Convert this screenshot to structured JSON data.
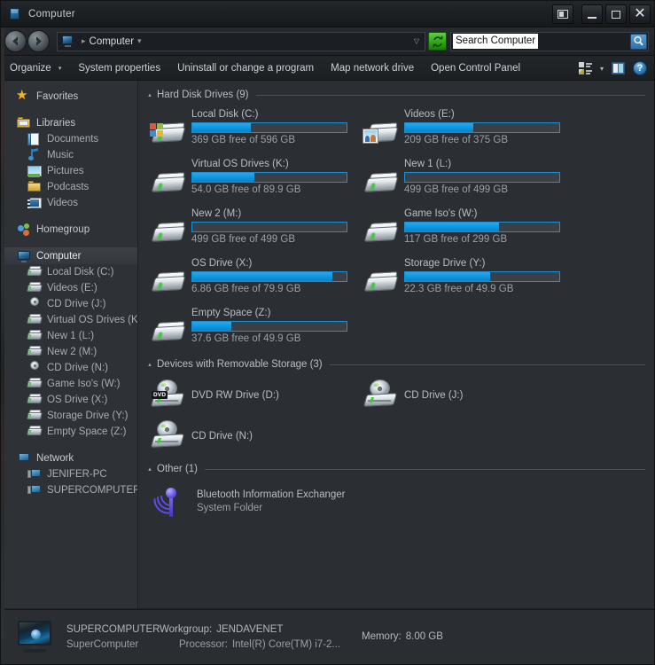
{
  "window": {
    "title": "Computer",
    "title_icon": "computer-icon",
    "controls": {
      "restore_down": "restore-down-icon",
      "minimize": "minimize-icon",
      "maximize": "maximize-icon",
      "close": "close-icon"
    }
  },
  "addressbar": {
    "back": "back-arrow-icon",
    "forward": "forward-arrow-icon",
    "crumb_icon": "computer-icon",
    "crumb": "Computer",
    "sep_left": "▸",
    "sep_right": "▾",
    "history_caret": "▽",
    "refresh": "refresh-icon"
  },
  "search": {
    "value": "Search Computer",
    "placeholder": "Search Computer",
    "icon": "search-icon"
  },
  "toolbar": {
    "items": [
      {
        "label": "Organize",
        "has_caret": true
      },
      {
        "label": "System properties",
        "has_caret": false
      },
      {
        "label": "Uninstall or change a program",
        "has_caret": false
      },
      {
        "label": "Map network drive",
        "has_caret": false
      },
      {
        "label": "Open Control Panel",
        "has_caret": false
      }
    ],
    "caret": "▾",
    "view_icon": "view-options-icon",
    "view_caret": "▾",
    "preview_pane_icon": "preview-pane-icon",
    "help_icon": "help-icon",
    "help_glyph": "?"
  },
  "navpane": {
    "favorites": {
      "label": "Favorites",
      "icon": "star-icon"
    },
    "libraries": {
      "label": "Libraries",
      "icon": "library-icon",
      "items": [
        {
          "label": "Documents",
          "icon": "documents-icon"
        },
        {
          "label": "Music",
          "icon": "music-icon"
        },
        {
          "label": "Pictures",
          "icon": "pictures-icon"
        },
        {
          "label": "Podcasts",
          "icon": "podcasts-icon"
        },
        {
          "label": "Videos",
          "icon": "videos-icon"
        }
      ]
    },
    "homegroup": {
      "label": "Homegroup",
      "icon": "homegroup-icon"
    },
    "computer": {
      "label": "Computer",
      "icon": "computer-icon",
      "selected": true,
      "items": [
        {
          "label": "Local Disk (C:)",
          "icon": "hdd-windows-icon"
        },
        {
          "label": "Videos (E:)",
          "icon": "hdd-pictures-icon"
        },
        {
          "label": "CD Drive (J:)",
          "icon": "cd-drive-icon"
        },
        {
          "label": "Virtual OS Drives (K:",
          "icon": "hdd-icon"
        },
        {
          "label": "New 1 (L:)",
          "icon": "hdd-icon"
        },
        {
          "label": "New 2 (M:)",
          "icon": "hdd-icon"
        },
        {
          "label": "CD Drive (N:)",
          "icon": "cd-drive-icon"
        },
        {
          "label": "Game Iso's (W:)",
          "icon": "hdd-icon"
        },
        {
          "label": "OS Drive (X:)",
          "icon": "hdd-icon"
        },
        {
          "label": "Storage Drive (Y:)",
          "icon": "hdd-icon"
        },
        {
          "label": "Empty Space (Z:)",
          "icon": "hdd-icon"
        }
      ]
    },
    "network": {
      "label": "Network",
      "icon": "network-icon",
      "items": [
        {
          "label": "JENIFER-PC",
          "icon": "network-computer-icon"
        },
        {
          "label": "SUPERCOMPUTER",
          "icon": "network-computer-icon"
        }
      ]
    }
  },
  "content": {
    "sections": [
      {
        "title": "Hard Disk Drives (9)",
        "caret": "▴",
        "kind": "drives",
        "items": [
          {
            "name": "Local Disk (C:)",
            "sub": "369 GB free of 596 GB",
            "used_pct": 38,
            "icon": "hdd-windows-icon"
          },
          {
            "name": "Videos (E:)",
            "sub": "209 GB free of 375 GB",
            "used_pct": 44,
            "icon": "hdd-pictures-icon"
          },
          {
            "name": "Virtual OS Drives (K:)",
            "sub": "54.0 GB free of 89.9 GB",
            "used_pct": 40,
            "icon": "hdd-icon"
          },
          {
            "name": "New 1 (L:)",
            "sub": "499 GB free of 499 GB",
            "used_pct": 0,
            "icon": "hdd-icon"
          },
          {
            "name": "New 2 (M:)",
            "sub": "499 GB free of 499 GB",
            "used_pct": 0,
            "icon": "hdd-icon"
          },
          {
            "name": "Game Iso's (W:)",
            "sub": "117 GB free of 299 GB",
            "used_pct": 61,
            "icon": "hdd-icon"
          },
          {
            "name": "OS Drive (X:)",
            "sub": "6.86 GB free of 79.9 GB",
            "used_pct": 91,
            "icon": "hdd-icon"
          },
          {
            "name": "Storage Drive (Y:)",
            "sub": "22.3 GB free of 49.9 GB",
            "used_pct": 55,
            "icon": "hdd-icon"
          },
          {
            "name": "Empty Space (Z:)",
            "sub": "37.6 GB free of 49.9 GB",
            "used_pct": 25,
            "icon": "hdd-icon"
          }
        ]
      },
      {
        "title": "Devices with Removable Storage (3)",
        "caret": "▴",
        "kind": "removable",
        "items": [
          {
            "name": "DVD RW Drive (D:)",
            "icon": "dvd-rw-drive-icon",
            "badge": "DVD"
          },
          {
            "name": "CD Drive (J:)",
            "icon": "cd-drive-icon",
            "badge": ""
          },
          {
            "name": "CD Drive (N:)",
            "icon": "cd-drive-icon",
            "badge": ""
          }
        ]
      },
      {
        "title": "Other (1)",
        "caret": "▴",
        "kind": "other",
        "items": [
          {
            "name": "Bluetooth Information Exchanger",
            "sub": "System Folder",
            "icon": "bluetooth-icon"
          }
        ]
      }
    ]
  },
  "statusbar": {
    "icon": "computer-monitor-icon",
    "computer_name": "SUPERCOMPUTER",
    "computer_desc": "SuperComputer",
    "workgroup_label": "Workgroup:",
    "workgroup_value": "JENDAVENET",
    "processor_label": "Processor:",
    "processor_value": "Intel(R) Core(TM) i7-2...",
    "memory_label": "Memory:",
    "memory_value": "8.00 GB"
  },
  "colors": {
    "accent_blue": "#0f94dd",
    "bar_border": "#1b8fd6",
    "window_bg": "#2b2f33",
    "navpane_bg": "#2e3237",
    "text": "#b9bec3"
  }
}
